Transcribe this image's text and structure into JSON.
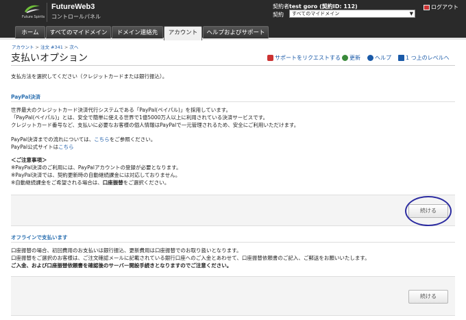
{
  "header": {
    "logo_text": "Future Spirits",
    "app_title": "FutureWeb3",
    "app_subtitle": "コントロールパネル",
    "account_prefix": "契約者",
    "account_name": "test goro (契約ID: 112)",
    "contract_label": "契約",
    "contract_select": "すべてのマイドメイン",
    "logout": "ログアウト"
  },
  "nav": {
    "tabs": [
      {
        "label": "ホーム",
        "active": false
      },
      {
        "label": "すべてのマイドメイン",
        "active": false
      },
      {
        "label": "ドメイン連絡先",
        "active": false
      },
      {
        "label": "アカウント",
        "active": true
      },
      {
        "label": "ヘルプおよびサポート",
        "active": false
      }
    ]
  },
  "breadcrumb": [
    "アカウント",
    "注文 #341",
    "次ヘ"
  ],
  "page": {
    "title": "支払いオプション",
    "actions": {
      "support": "サポートをリクエストする",
      "refresh": "更新",
      "help": "ヘルプ",
      "up": "1 つ上のレベルへ"
    },
    "instruction": "支払方法を選択してください（クレジットカードまたは銀行振込）。"
  },
  "paypal": {
    "heading": "PayPal決済",
    "line1": "世界最大のクレジットカード決済代行システムである「PayPal(ペイパル)」を採用しています。",
    "line2": "「PayPal(ペイパル)」とは、安全で簡単に使える世界で1億5000万人以上に利用されている決済サービスです。",
    "line3": "クレジットカード番号など、支払いに必要なお客様の個人情報はPayPalで一元管理されるため、安全にご利用いただけます。",
    "flow_text": "PayPal決済までの流れについては、",
    "flow_link": "こちら",
    "flow_suffix": "をご参照ください。",
    "official_text": "PayPal公式サイトは",
    "official_link": "こちら",
    "notes_head": "＜ご注意事項＞",
    "note1": "※PayPal決済のご利用には、PayPalアカウントの登録が必要となります。",
    "note2": "※PayPal決済では、契約更新時の自動継続課金には対応しておりません。",
    "note3_prefix": "※自動継続課金をご希望される場合は、",
    "note3_bold": "口座振替",
    "note3_suffix": "をご選択ください。",
    "continue_label": "続ける"
  },
  "offline": {
    "heading": "オフラインで支払います",
    "line1": "口座振替の場合、初回費用のお支払いは銀行振込、更新費用は口座振替でのお取り扱いとなります。",
    "line2": "口座振替をご選択のお客様は、ご注文確認メールに記載されている銀行口座へのご入金とあわせて、口座振替依頼書のご記入、ご郵送をお願いいたします。",
    "line3": "ご入金、および口座振替依頼書を確認後のサーバー開設手続きとなりますのでご注意ください。",
    "continue_label": "続ける"
  },
  "colors": {
    "header_bg": "#2a2a2a",
    "link": "#1a5aa8",
    "section_heading": "#2a6fb0",
    "annotation_circle": "#2b2ba0"
  }
}
